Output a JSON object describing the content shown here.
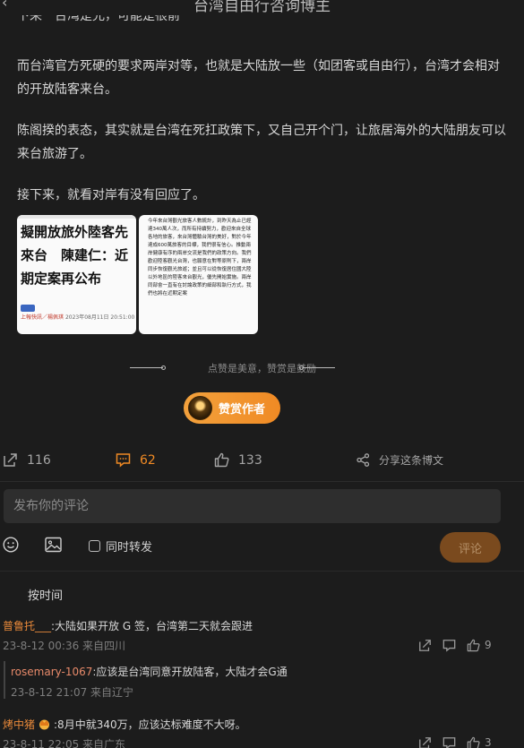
{
  "header": {
    "title": "台湾自由行咨询博主",
    "back_label": "‹"
  },
  "article": {
    "cut_line": "下来一台湾是允，可能是很前",
    "paragraphs": [
      "而台湾官方死硬的要求两岸对等，也就是大陆放一些（如团客或自由行），台湾才会相对的开放陆客来台。",
      "陈阁揆的表态，其实就是台湾在死扛政策下，又自己开个门，让旅居海外的大陆朋友可以来台旅游了。",
      "接下来，就看对岸有没有回应了。"
    ],
    "images": {
      "news": {
        "headline": "擬開放旅外陸客先來台　陳建仁：近期定案再公布",
        "source": "上報快訊／楊佩琪",
        "datetime": "2023年08月11日 20:51:00"
      },
      "text": "今年來台灣觀光旅客人數統計，到昨天為止已經達340萬人次，而所有持續努力，歡迎來自全球各地的旅客，來台灣體驗台灣的美好，對於今年達成600萬旅客的目標，我們很有信心。推動兩岸健康有序的兩岸交流是我們的政策方向。我們歡迎陸客觀光台灣，也願意在對等原則下，兩岸同步恢復觀光旅遊；並且可以從恢復居住國大陸以外地區的陸客來台觀光，優先開始實施。兩岸同部會一直有在討論政策的細部和執行方式，我們也將在近期定案"
    }
  },
  "separator": {
    "text": "点赞是美意，赞赏是鼓励"
  },
  "reward": {
    "label": "赞赏作者"
  },
  "actions": {
    "repost_count": "116",
    "comment_count": "62",
    "like_count": "133",
    "share_label": "分享这条博文"
  },
  "comment_box": {
    "placeholder": "发布你的评论",
    "repost_label": "同时转发",
    "submit_label": "评论"
  },
  "sort_label": "按时间",
  "comments": [
    {
      "user": "普鲁托___",
      "text": ":大陆如果开放 G 签，台湾第二天就会跟进",
      "meta": "23-8-12 00:36 来自四川",
      "likes": "9"
    },
    {
      "user": "rosemary-1067",
      "text": ":应该是台湾同意开放陆客，大陆才会G通",
      "meta": "23-8-12 21:07 来自辽宁"
    },
    {
      "user": "烤中猪",
      "text": ":8月中就340万，应该达标难度不大呀。",
      "meta": "23-8-11 22:05 来自广东",
      "likes": "3"
    }
  ],
  "colors": {
    "accent": "#f08a24",
    "background": "#1c1c1c",
    "username": "#e8893a"
  }
}
